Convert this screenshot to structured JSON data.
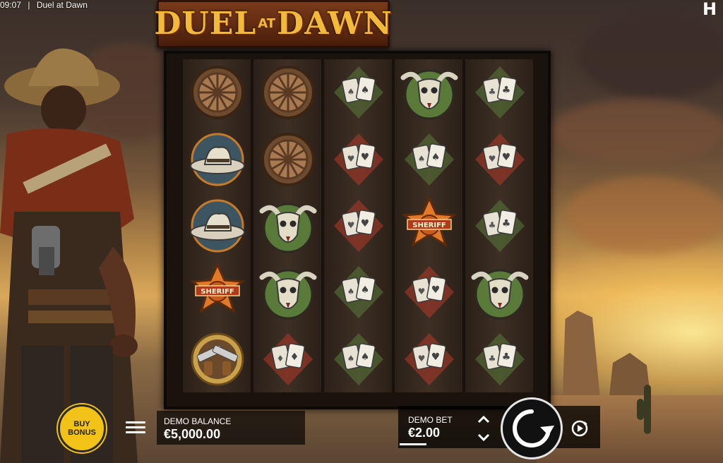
{
  "status_bar": {
    "time": "09:07",
    "separator": "|",
    "title": "Duel at Dawn"
  },
  "brand": {
    "icon": "hacksaw-h-logo",
    "letter": "H"
  },
  "logo": {
    "word1": "DUEL",
    "word2": "AT",
    "word3": "DAWN"
  },
  "grid": {
    "columns": 5,
    "rows": [
      [
        "wheel",
        "wheel",
        "cards-spades",
        "bull-skull",
        "cards-clubs"
      ],
      [
        "hat",
        "wheel",
        "cards-hearts",
        "cards-spades",
        "cards-hearts"
      ],
      [
        "hat",
        "bull-skull",
        "cards-hearts",
        "sheriff-badge",
        "cards-clubs"
      ],
      [
        "sheriff-badge",
        "bull-skull",
        "cards-spades",
        "cards-hearts",
        "bull-skull"
      ],
      [
        "revolvers",
        "cards-diamonds",
        "cards-spades",
        "cards-hearts",
        "cards-clubs"
      ]
    ]
  },
  "sheriff_label": "SHERIFF",
  "controls": {
    "buy_bonus_line1": "BUY",
    "buy_bonus_line2": "BONUS",
    "balance_label": "DEMO BALANCE",
    "balance_value": "€5,000.00",
    "bet_label": "DEMO BET",
    "bet_value": "€2.00"
  },
  "colors": {
    "buy_bonus": "#f2c218",
    "logo_text": "#f3b93a",
    "panel_bg": "#000000",
    "badge_orange": "#e07a2a",
    "card_green": "#5a7a3a",
    "card_red": "#b33a2a"
  }
}
